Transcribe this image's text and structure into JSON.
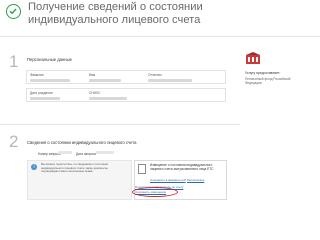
{
  "header": {
    "title": "Получение сведений о состоянии индивидуального лицевого счета"
  },
  "step1": {
    "number": "1",
    "label": "Персональные данные",
    "fields": [
      {
        "label": "Фамилия"
      },
      {
        "label": "Имя"
      },
      {
        "label": "Отчество"
      },
      {
        "label": "Дата рождения"
      },
      {
        "label": "СНИЛС"
      }
    ]
  },
  "provider": {
    "label": "Услугу предоставляет:",
    "name": "Пенсионный фонд Российской Федерации"
  },
  "step2": {
    "number": "2",
    "label": "Сведения о состоянии индивидуального лицевого счета",
    "request_number_label": "Номер запроса",
    "request_date_label": "Дата запроса"
  },
  "notice": {
    "text": "Вы можете пересчитать, по сведениям о состоянии индивидуального лицевого счета, какие документы подтверждают ваши пенсионные права"
  },
  "document": {
    "title": "Извещение о состоянии индивидуального лицевого счета застрахованного лица ЕТС",
    "format": "pdf",
    "links": {
      "save": "Сохранить в формате pdf",
      "print": "Распечатать",
      "view": "Посмотреть информацию по счету",
      "save_as": "Сохранить извещение"
    }
  },
  "colors": {
    "accent": "#2c9c4a",
    "link": "#2a6db5",
    "highlight": "#d32020"
  }
}
